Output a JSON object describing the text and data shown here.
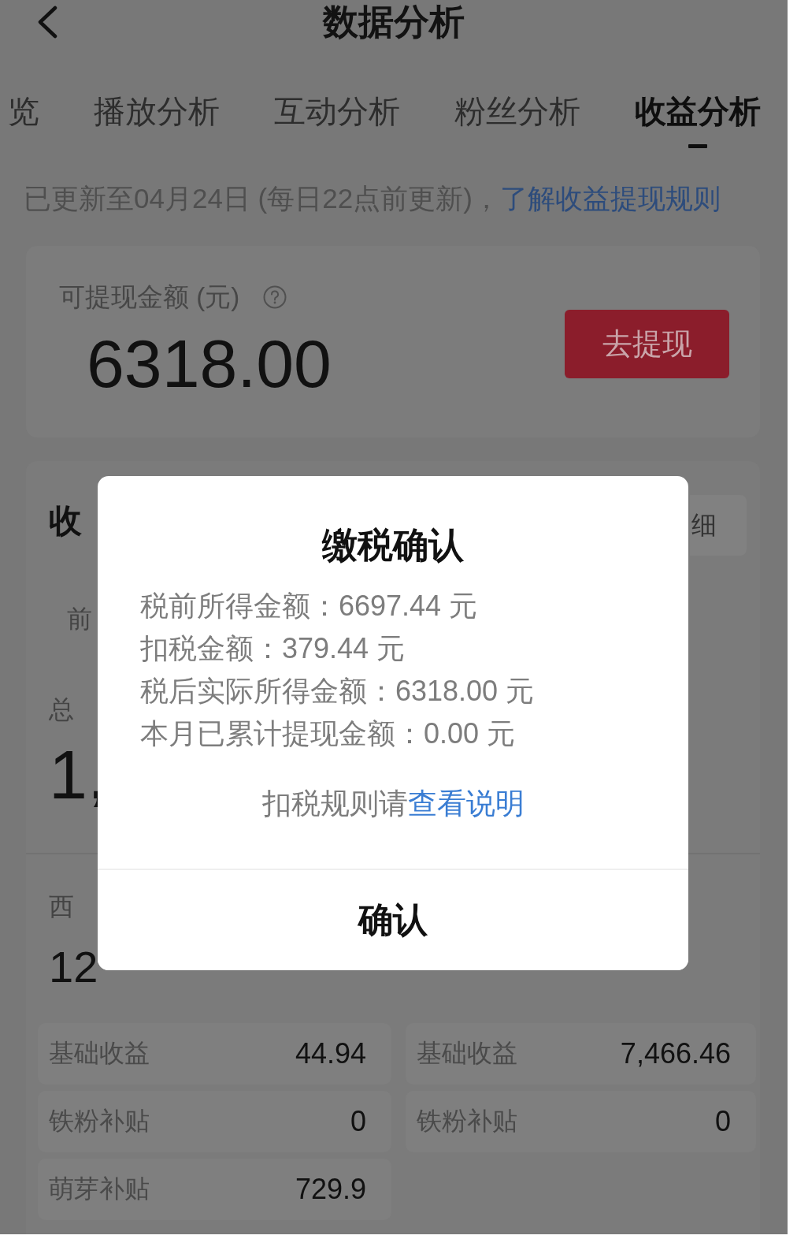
{
  "header": {
    "title": "数据分析"
  },
  "tabs": [
    {
      "label": "览",
      "selected": false
    },
    {
      "label": "播放分析",
      "selected": false
    },
    {
      "label": "互动分析",
      "selected": false
    },
    {
      "label": "粉丝分析",
      "selected": false
    },
    {
      "label": "收益分析",
      "selected": true
    }
  ],
  "update_notice": {
    "text": "已更新至04月24日 (每日22点前更新)，",
    "link": "了解收益提现规则"
  },
  "balance_card": {
    "label": "可提现金额 (元)",
    "amount": "6318.00",
    "button": "去提现"
  },
  "income_card": {
    "title": "收",
    "details_button": "细",
    "period_tab": "前",
    "total_label": "总",
    "total_value": "1,",
    "sources": [
      {
        "label": "西",
        "amount": "12",
        "rows": [
          {
            "label": "基础收益",
            "value": "44.94"
          },
          {
            "label": "铁粉补贴",
            "value": "0"
          },
          {
            "label": "萌芽补贴",
            "value": "729.9"
          }
        ]
      },
      {
        "rows": [
          {
            "label": "基础收益",
            "value": "7,466.46"
          },
          {
            "label": "铁粉补贴",
            "value": "0"
          }
        ]
      }
    ]
  },
  "tax_dialog": {
    "title": "缴税确认",
    "lines": [
      "税前所得金额：6697.44 元",
      "扣税金额：379.44 元",
      "税后实际所得金额：6318.00 元",
      "本月已累计提现金额：0.00 元"
    ],
    "note": "扣税规则请",
    "note_link": "查看说明",
    "confirm_button": "确认"
  }
}
